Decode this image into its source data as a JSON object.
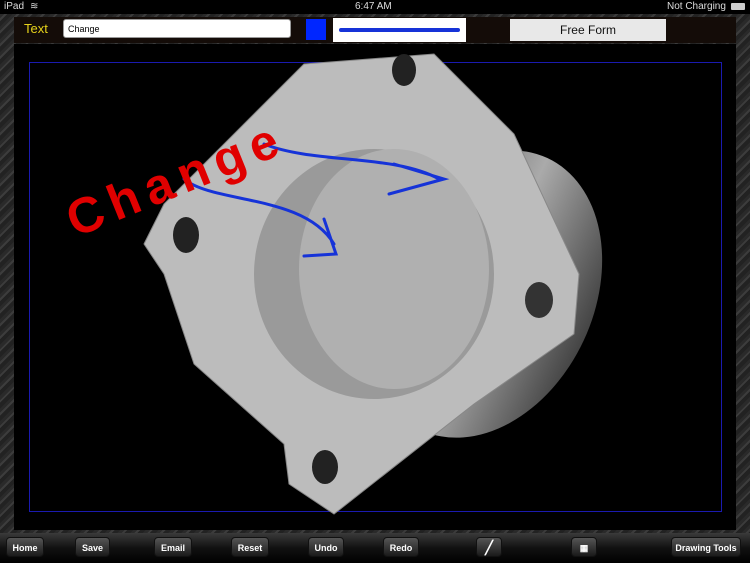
{
  "status": {
    "device": "iPad",
    "time": "6:47 AM",
    "battery": "Not Charging"
  },
  "toolbar": {
    "text_label": "Text",
    "text_value": "Change",
    "color": "#0026ff",
    "mode": "Free Form"
  },
  "canvas": {
    "annotation": "Change",
    "annotation_color": "#e00000",
    "pen_color": "#1633d8"
  },
  "bottom": {
    "home": "Home",
    "save": "Save",
    "email": "Email",
    "reset": "Reset",
    "undo": "Undo",
    "redo": "Redo",
    "pen_icon": "pen-icon",
    "grid_icon": "grid-icon",
    "tools": "Drawing Tools"
  }
}
